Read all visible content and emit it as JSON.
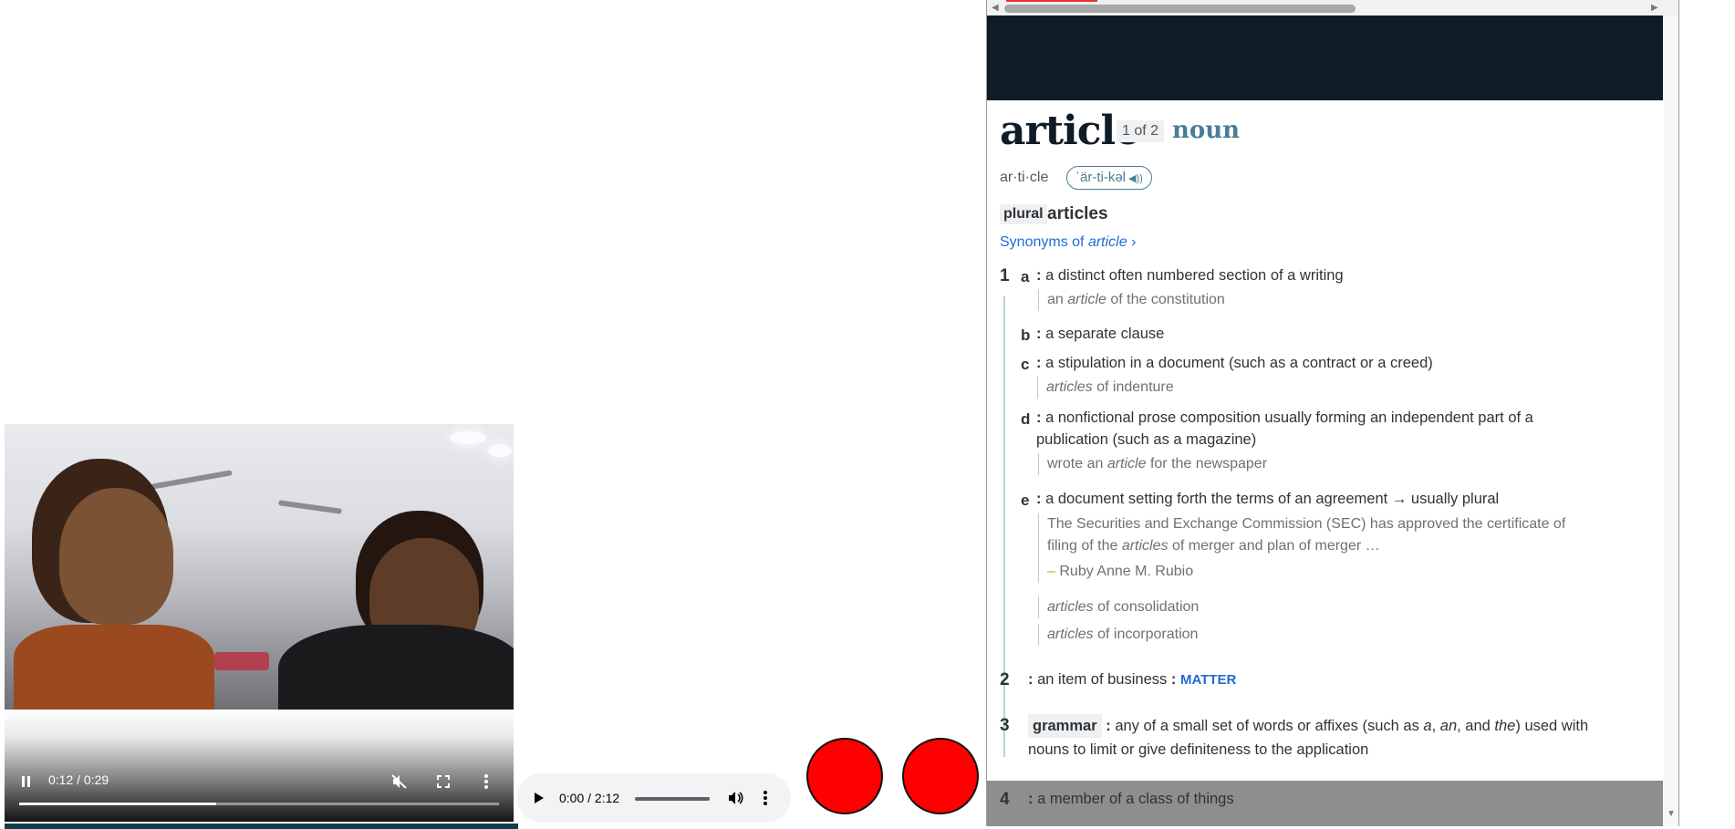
{
  "video": {
    "time": "0:12 / 0:29",
    "progress_fraction": 0.41,
    "icons": [
      "pause-icon",
      "muted-icon",
      "fullscreen-icon",
      "more-options-icon"
    ]
  },
  "audio": {
    "time": "0:00 / 2:12",
    "icons": [
      "play-icon",
      "volume-icon",
      "more-options-icon"
    ]
  },
  "colors": {
    "red_circle": "#ff0000",
    "banner": "#0f1c28",
    "link": "#1f6bd6",
    "accent": "#4a7d95"
  },
  "dictionary": {
    "headword": "article",
    "entry_count": "1 of 2",
    "part_of_speech": "noun",
    "syllables": "ar·ti·cle",
    "pronunciation": "ˈär-ti-kəl",
    "plural_label": "plural",
    "plural_form": "articles",
    "synonyms_prefix": "Synonyms of ",
    "synonyms_word": "article",
    "senses": {
      "s1": {
        "num": "1"
      },
      "s1a": {
        "letter": "a",
        "def": "a distinct often numbered section of a writing",
        "ex_pre": "an ",
        "ex_em": "article",
        "ex_post": " of the constitution"
      },
      "s1b": {
        "letter": "b",
        "def": "a separate clause"
      },
      "s1c": {
        "letter": "c",
        "def": "a stipulation in a document (such as a contract or a creed)",
        "ex_em": "articles",
        "ex_post": " of indenture"
      },
      "s1d": {
        "letter": "d",
        "def_line1": "a nonfictional prose composition usually forming an independent part of a",
        "def_line2": "publication (such as a magazine)",
        "ex_pre": "wrote an ",
        "ex_em": "article",
        "ex_post": " for the newspaper"
      },
      "s1e": {
        "letter": "e",
        "def": "a document setting forth the terms of an agreement",
        "note": "usually plural",
        "quote_line1": "The Securities and Exchange Commission (SEC) has approved the certificate of",
        "quote_line2_pre": "filing of the ",
        "quote_line2_em": "articles",
        "quote_line2_post": " of merger and plan of merger …",
        "attribution": "Ruby Anne M. Rubio",
        "ex2_em": "articles",
        "ex2_post": " of consolidation",
        "ex3_em": "articles",
        "ex3_post": " of incorporation"
      },
      "s2": {
        "num": "2",
        "def": "an item of business",
        "xref": "MATTER"
      },
      "s3": {
        "num": "3",
        "tag": "grammar",
        "def_line1_pre": "any of a small set of words or affixes (such as ",
        "w1": "a",
        "sep1": ", ",
        "w2": "an",
        "sep2": ", and ",
        "w3": "the",
        "def_line1_post": ") used with",
        "def_line2": "nouns to limit or give definiteness to the application"
      },
      "s4": {
        "num": "4",
        "def": "a member of a class of things"
      }
    }
  }
}
